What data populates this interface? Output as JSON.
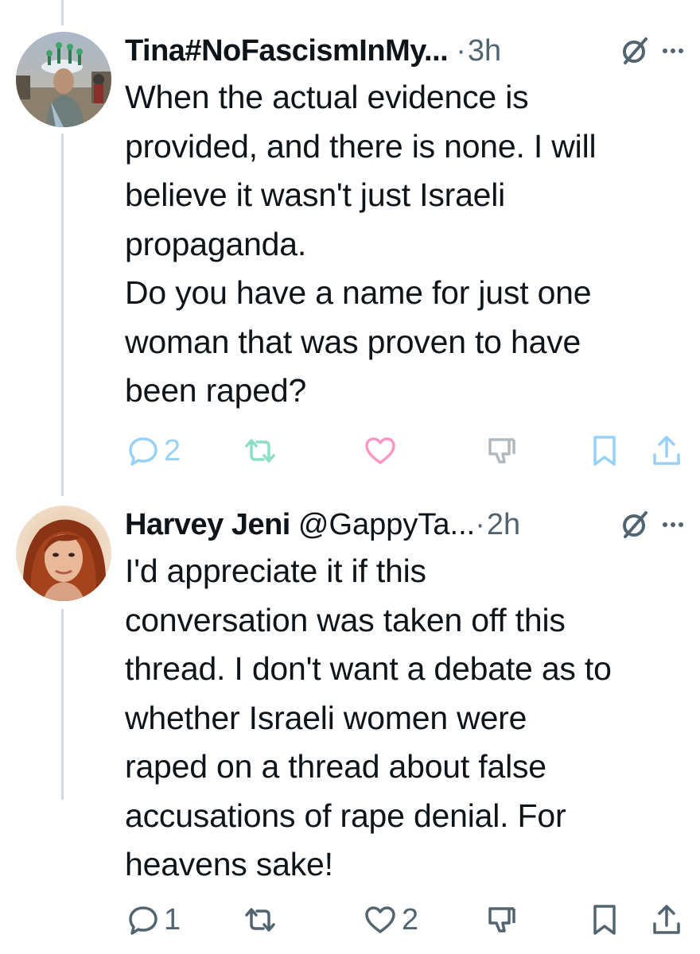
{
  "tweets": [
    {
      "display_name": "Tina#NoFascismInMy...",
      "handle": "",
      "separator": "·",
      "time": "3h",
      "text": "When the actual evidence is\nprovided, and there is none. I will\nbelieve it wasn't just Israeli\npropaganda.\nDo you have a name for just one\nwoman that was proven to have\nbeen raped?",
      "reply_count": "2",
      "retweet_count": "",
      "like_count": "",
      "icons": [
        "grok-icon",
        "more-icon",
        "reply-icon",
        "retweet-icon",
        "like-icon",
        "dislike-icon",
        "bookmark-icon",
        "share-icon"
      ]
    },
    {
      "display_name": "Harvey Jeni",
      "handle": "@GappyTa...",
      "separator": "·",
      "time": "2h",
      "text": "I'd appreciate it if this\nconversation was taken off this\nthread. I don't want a debate as to\nwhether Israeli women were\nraped on a thread about false\naccusations of rape denial. For\nheavens sake!",
      "reply_count": "1",
      "retweet_count": "",
      "like_count": "2",
      "icons": [
        "grok-icon",
        "more-icon",
        "reply-icon",
        "retweet-icon",
        "like-icon",
        "dislike-icon",
        "bookmark-icon",
        "share-icon"
      ]
    }
  ],
  "colors": {
    "text": "#0f1419",
    "secondary": "#536471",
    "thread_line": "#cfd9de"
  }
}
